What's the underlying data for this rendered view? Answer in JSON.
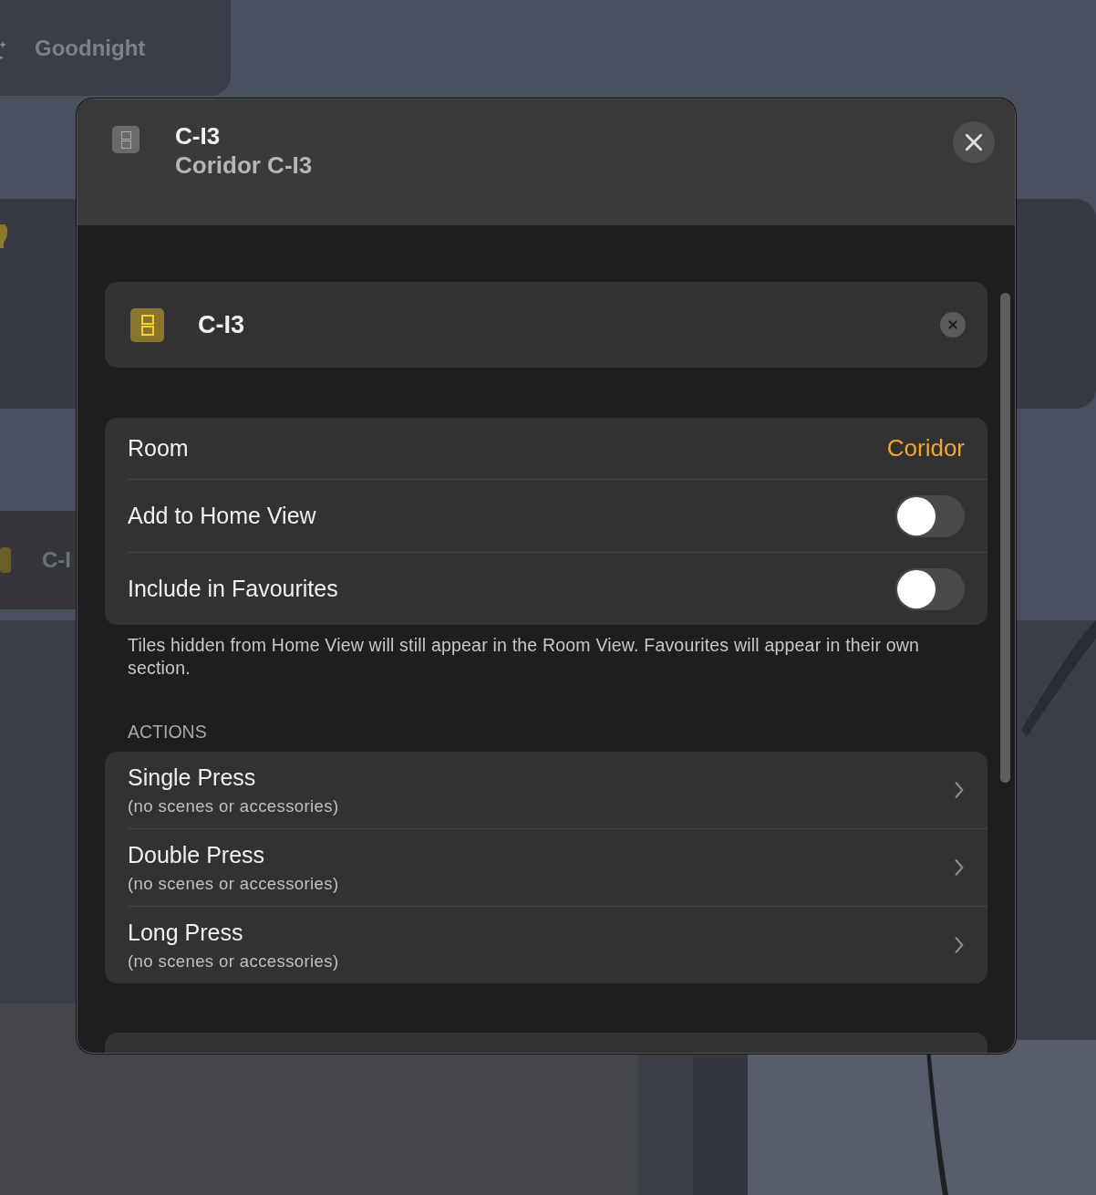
{
  "background": {
    "tiles": [
      {
        "label": "Goodnight"
      },
      {
        "label": "C-I"
      }
    ]
  },
  "dialog": {
    "title": "C-I3",
    "subtitle": "Coridor C-I3",
    "accessory": {
      "name": "C-I3"
    },
    "settings": [
      {
        "kind": "value",
        "label": "Room",
        "value": "Coridor"
      },
      {
        "kind": "toggle",
        "label": "Add to Home View",
        "on": false
      },
      {
        "kind": "toggle",
        "label": "Include in Favourites",
        "on": false
      }
    ],
    "footnote": "Tiles hidden from Home View will still appear in the Room View. Favourites will appear in their own section.",
    "actions_header": "ACTIONS",
    "actions": [
      {
        "title": "Single Press",
        "detail": "(no scenes or accessories)"
      },
      {
        "title": "Double Press",
        "detail": "(no scenes or accessories)"
      },
      {
        "title": "Long Press",
        "detail": "(no scenes or accessories)"
      }
    ]
  }
}
